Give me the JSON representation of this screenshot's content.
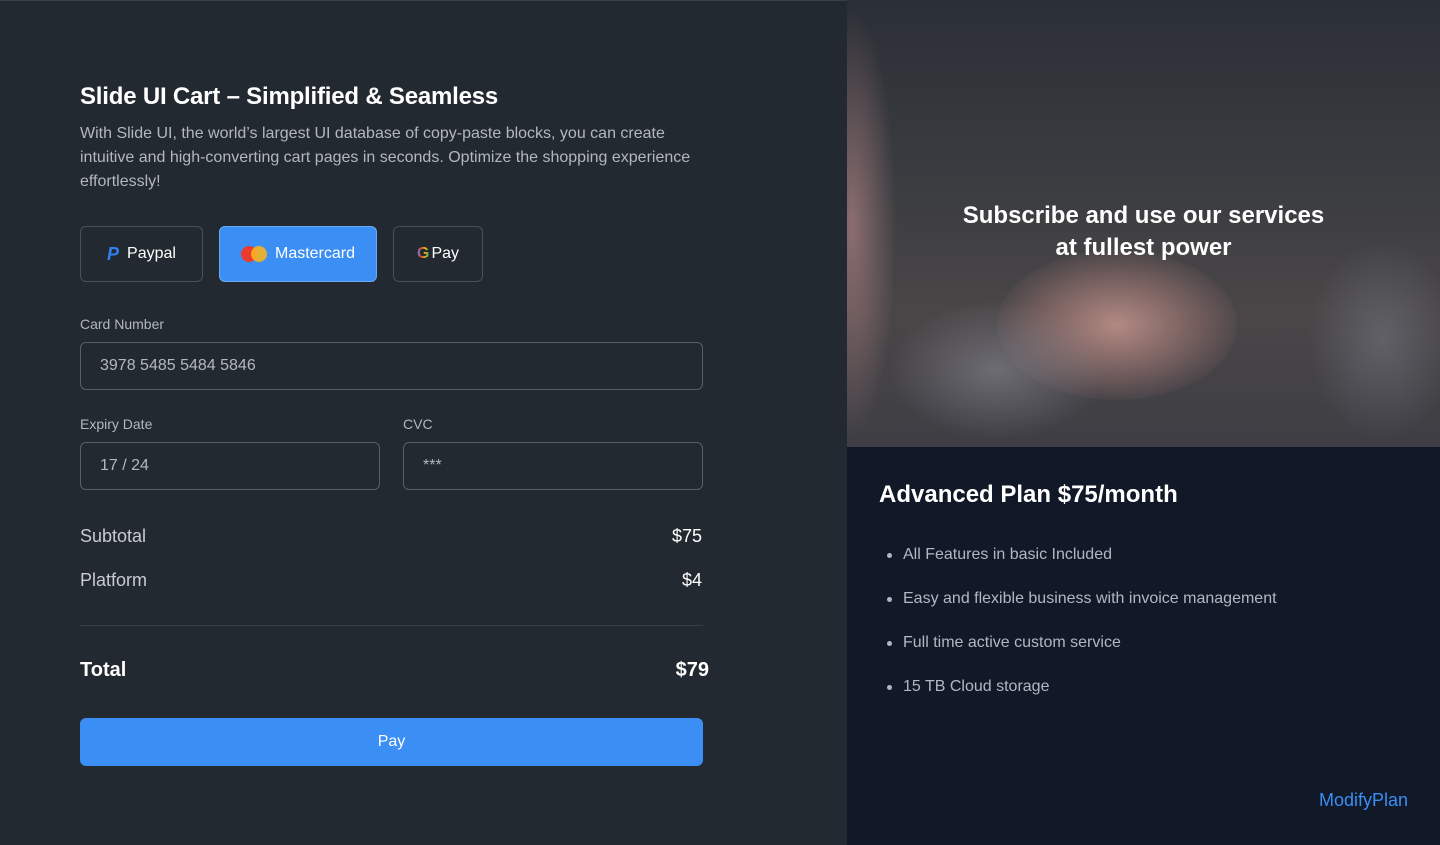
{
  "cart": {
    "title": "Slide UI Cart – Simplified & Seamless",
    "description": "With Slide UI, the world’s largest UI database of copy-paste blocks, you can create intuitive and high-converting cart pages in seconds. Optimize the shopping experience effortlessly!",
    "payment_methods": [
      {
        "label": "Paypal",
        "icon": "paypal-icon",
        "selected": false
      },
      {
        "label": "Mastercard",
        "icon": "mastercard-icon",
        "selected": true
      },
      {
        "label": "Pay",
        "icon": "google-icon",
        "selected": false
      }
    ],
    "card_number_label": "Card Number",
    "card_number_value": "3978 5485 5484 5846",
    "expiry_label": "Expiry Date",
    "expiry_value": "17 / 24",
    "cvc_label": "CVC",
    "cvc_value": "***",
    "subtotal_label": "Subtotal",
    "subtotal_value": "$75",
    "platform_label": "Platform",
    "platform_value": "$4",
    "total_label": "Total",
    "total_value": "$79",
    "pay_button": "Pay"
  },
  "promo": {
    "headline_line1": "Subscribe and use our services",
    "headline_line2": "at fullest power"
  },
  "plan": {
    "title": "Advanced Plan $75/month",
    "features": [
      "All Features in basic Included",
      "Easy and flexible business with invoice management",
      "Full time active custom service",
      "15 TB Cloud storage"
    ],
    "modify_link": "ModifyPlan"
  },
  "colors": {
    "accent": "#3b8ef3",
    "left_bg": "#232930",
    "right_bg": "#111827"
  }
}
